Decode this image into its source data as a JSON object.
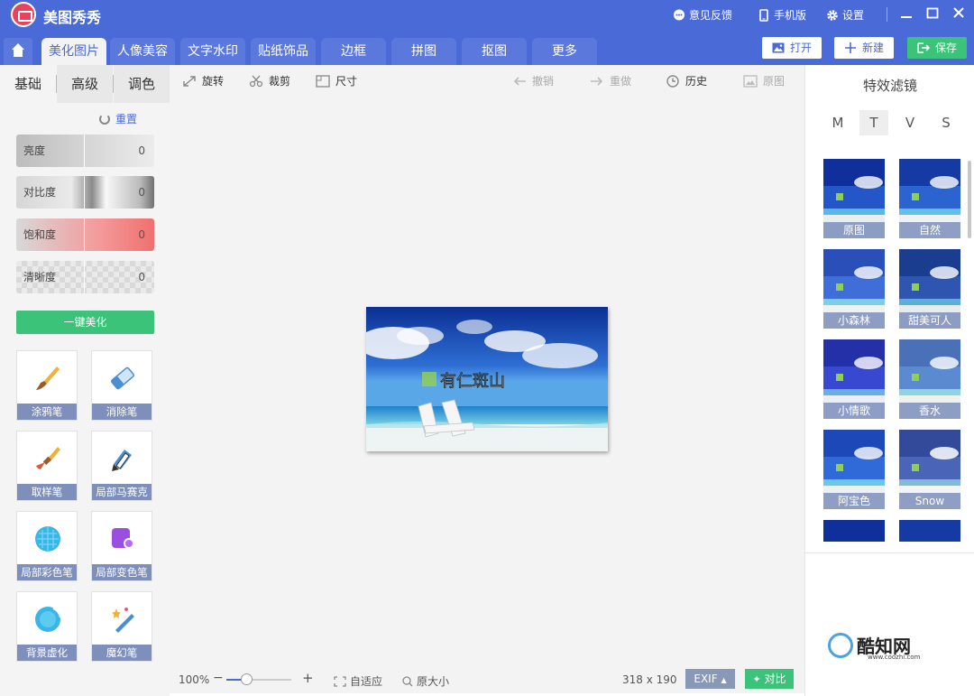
{
  "app": {
    "name": "美图秀秀"
  },
  "titlebar": {
    "feedback": "意见反馈",
    "mobile": "手机版",
    "settings": "设置"
  },
  "tabs": [
    "美化图片",
    "人像美容",
    "文字水印",
    "贴纸饰品",
    "边框",
    "拼图",
    "抠图",
    "更多"
  ],
  "top_buttons": {
    "open": "打开",
    "new": "新建",
    "save": "保存"
  },
  "left_panel": {
    "subtabs": [
      "基础",
      "高级",
      "调色"
    ],
    "reset": "重置",
    "sliders": [
      {
        "label": "亮度",
        "value": "0"
      },
      {
        "label": "对比度",
        "value": "0"
      },
      {
        "label": "饱和度",
        "value": "0"
      },
      {
        "label": "清晰度",
        "value": "0"
      }
    ],
    "one_click": "一键美化",
    "tools": [
      "涂鸦笔",
      "消除笔",
      "取样笔",
      "局部马赛克",
      "局部彩色笔",
      "局部变色笔",
      "背景虚化",
      "魔幻笔"
    ]
  },
  "toolbar": {
    "rotate": "旋转",
    "crop": "裁剪",
    "size": "尺寸",
    "undo": "撤销",
    "redo": "重做",
    "history": "历史",
    "original": "原图"
  },
  "photo": {
    "caption": "有仁斑山"
  },
  "statusbar": {
    "zoom": "100%",
    "fit": "自适应",
    "actual": "原大小",
    "dimensions": "318 x 190",
    "exif": "EXIF",
    "compare": "对比"
  },
  "right_panel": {
    "title": "特效滤镜",
    "filter_tabs": [
      "M",
      "T",
      "V",
      "S"
    ],
    "filters": [
      "原图",
      "自然",
      "小森林",
      "甜美可人",
      "小情歌",
      "香水",
      "阿宝色",
      "Snow"
    ]
  },
  "watermark": {
    "text": "酷知网",
    "url": "www.coozhi.com"
  },
  "colors": {
    "primary": "#4a6ad7",
    "green": "#3cc37a"
  }
}
